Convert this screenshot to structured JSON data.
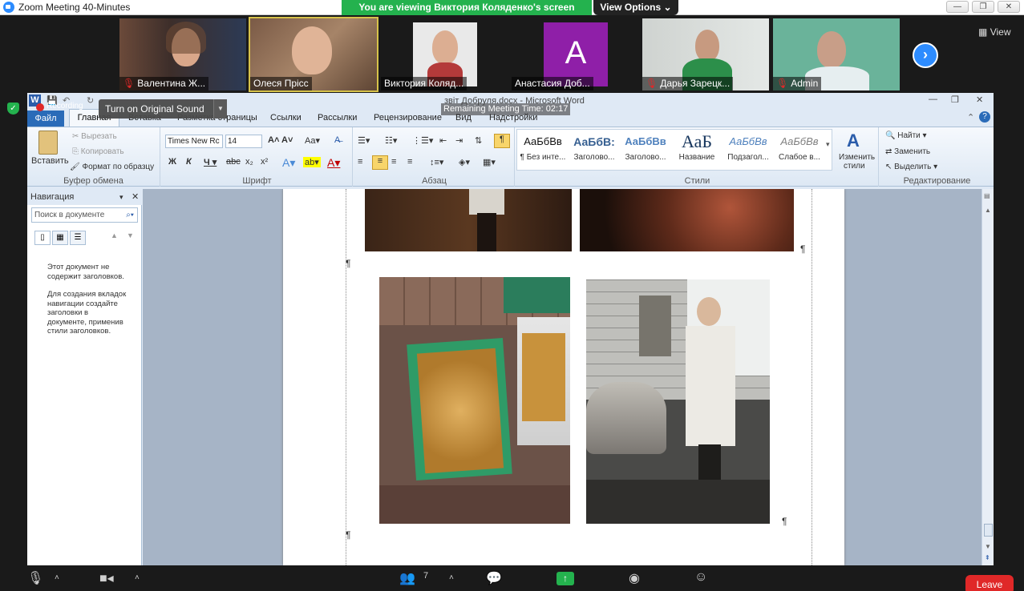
{
  "zoom": {
    "window_title": "Zoom Meeting 40-Minutes",
    "viewing_banner": "You are viewing Виктория Коляденко's screen",
    "view_options": "View Options",
    "view_button": "View",
    "remaining_time": "Remaining Meeting Time: 02:17",
    "original_sound": "Turn on Original Sound",
    "participants": [
      {
        "name": "Валентина Ж...",
        "muted": true
      },
      {
        "name": "Олеся Прісс",
        "muted": false
      },
      {
        "name": "Виктория Коляд...",
        "muted": false
      },
      {
        "name": "Анастасия Доб...",
        "muted": false,
        "avatar_letter": "A"
      },
      {
        "name": "Дарья Зарецк...",
        "muted": true
      },
      {
        "name": "Admin",
        "muted": true
      }
    ],
    "participant_count": "7",
    "leave": "Leave",
    "recording": "Recording"
  },
  "word": {
    "title": "звіт Добруля.docx - Microsoft Word",
    "tabs": [
      "Файл",
      "Главная",
      "Вставка",
      "Разметка страницы",
      "Ссылки",
      "Рассылки",
      "Рецензирование",
      "Вид",
      "Надстройки"
    ],
    "clipboard": {
      "paste": "Вставить",
      "cut": "Вырезать",
      "copy": "Копировать",
      "format_painter": "Формат по образцу",
      "label": "Буфер обмена"
    },
    "font": {
      "name": "Times New Rc",
      "size": "14",
      "label": "Шрифт"
    },
    "paragraph_label": "Абзац",
    "styles": {
      "items": [
        {
          "preview": "АаБбВв",
          "name": "¶ Без инте..."
        },
        {
          "preview": "АаБбВ:",
          "name": "Заголово..."
        },
        {
          "preview": "АаБбВв",
          "name": "Заголово..."
        },
        {
          "preview": "АаБ",
          "name": "Название"
        },
        {
          "preview": "АаБбВв",
          "name": "Подзагол..."
        },
        {
          "preview": "АаБбВв",
          "name": "Слабое в..."
        }
      ],
      "change_line1": "Изменить",
      "change_line2": "стили",
      "label": "Стили"
    },
    "editing": {
      "find": "Найти",
      "replace": "Заменить",
      "select": "Выделить",
      "label": "Редактирование"
    },
    "nav": {
      "title": "Навигация",
      "search_placeholder": "Поиск в документе",
      "msg1": "Этот документ не содержит заголовков.",
      "msg2": "Для создания вкладок навигации создайте заголовки в документе, применив стили заголовков."
    }
  },
  "colors": {
    "accent": "#2d8cff",
    "banner": "#24b24e",
    "leave": "#e02828"
  }
}
